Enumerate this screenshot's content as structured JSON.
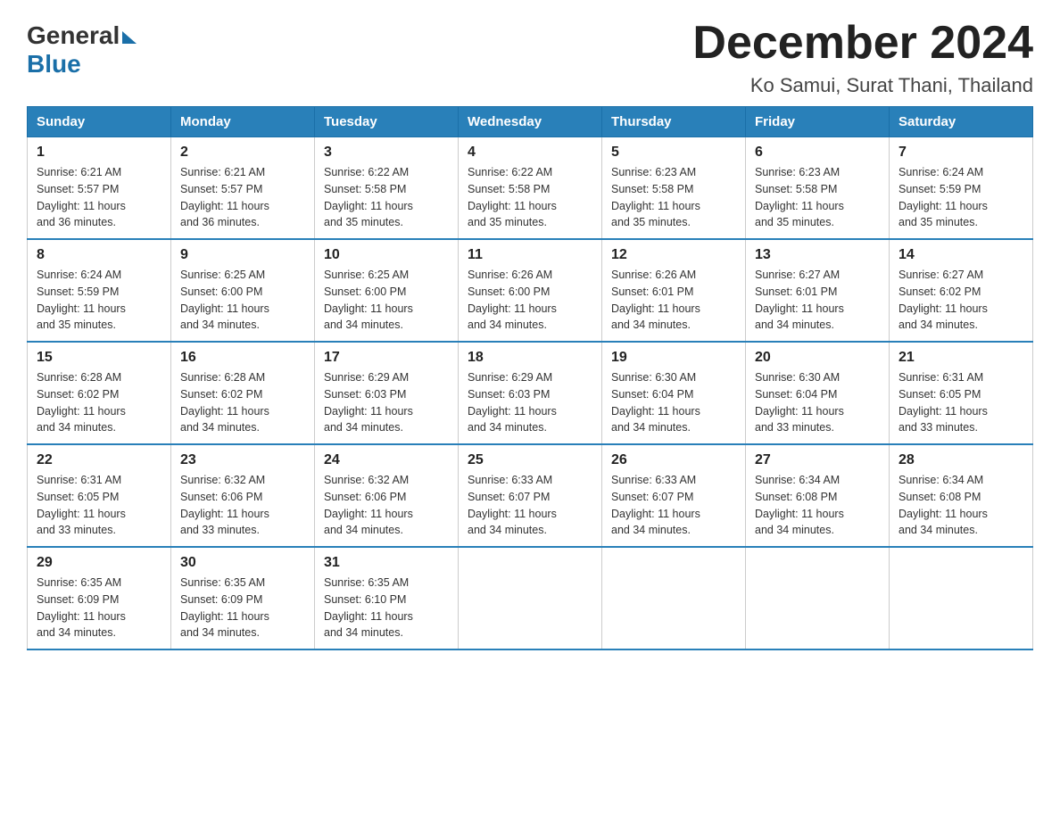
{
  "header": {
    "logo": {
      "general": "General",
      "blue": "Blue",
      "arrow_alt": "triangle arrow"
    },
    "title": "December 2024",
    "subtitle": "Ko Samui, Surat Thani, Thailand"
  },
  "calendar": {
    "headers": [
      "Sunday",
      "Monday",
      "Tuesday",
      "Wednesday",
      "Thursday",
      "Friday",
      "Saturday"
    ],
    "weeks": [
      [
        {
          "day": "1",
          "info": "Sunrise: 6:21 AM\nSunset: 5:57 PM\nDaylight: 11 hours\nand 36 minutes."
        },
        {
          "day": "2",
          "info": "Sunrise: 6:21 AM\nSunset: 5:57 PM\nDaylight: 11 hours\nand 36 minutes."
        },
        {
          "day": "3",
          "info": "Sunrise: 6:22 AM\nSunset: 5:58 PM\nDaylight: 11 hours\nand 35 minutes."
        },
        {
          "day": "4",
          "info": "Sunrise: 6:22 AM\nSunset: 5:58 PM\nDaylight: 11 hours\nand 35 minutes."
        },
        {
          "day": "5",
          "info": "Sunrise: 6:23 AM\nSunset: 5:58 PM\nDaylight: 11 hours\nand 35 minutes."
        },
        {
          "day": "6",
          "info": "Sunrise: 6:23 AM\nSunset: 5:58 PM\nDaylight: 11 hours\nand 35 minutes."
        },
        {
          "day": "7",
          "info": "Sunrise: 6:24 AM\nSunset: 5:59 PM\nDaylight: 11 hours\nand 35 minutes."
        }
      ],
      [
        {
          "day": "8",
          "info": "Sunrise: 6:24 AM\nSunset: 5:59 PM\nDaylight: 11 hours\nand 35 minutes."
        },
        {
          "day": "9",
          "info": "Sunrise: 6:25 AM\nSunset: 6:00 PM\nDaylight: 11 hours\nand 34 minutes."
        },
        {
          "day": "10",
          "info": "Sunrise: 6:25 AM\nSunset: 6:00 PM\nDaylight: 11 hours\nand 34 minutes."
        },
        {
          "day": "11",
          "info": "Sunrise: 6:26 AM\nSunset: 6:00 PM\nDaylight: 11 hours\nand 34 minutes."
        },
        {
          "day": "12",
          "info": "Sunrise: 6:26 AM\nSunset: 6:01 PM\nDaylight: 11 hours\nand 34 minutes."
        },
        {
          "day": "13",
          "info": "Sunrise: 6:27 AM\nSunset: 6:01 PM\nDaylight: 11 hours\nand 34 minutes."
        },
        {
          "day": "14",
          "info": "Sunrise: 6:27 AM\nSunset: 6:02 PM\nDaylight: 11 hours\nand 34 minutes."
        }
      ],
      [
        {
          "day": "15",
          "info": "Sunrise: 6:28 AM\nSunset: 6:02 PM\nDaylight: 11 hours\nand 34 minutes."
        },
        {
          "day": "16",
          "info": "Sunrise: 6:28 AM\nSunset: 6:02 PM\nDaylight: 11 hours\nand 34 minutes."
        },
        {
          "day": "17",
          "info": "Sunrise: 6:29 AM\nSunset: 6:03 PM\nDaylight: 11 hours\nand 34 minutes."
        },
        {
          "day": "18",
          "info": "Sunrise: 6:29 AM\nSunset: 6:03 PM\nDaylight: 11 hours\nand 34 minutes."
        },
        {
          "day": "19",
          "info": "Sunrise: 6:30 AM\nSunset: 6:04 PM\nDaylight: 11 hours\nand 34 minutes."
        },
        {
          "day": "20",
          "info": "Sunrise: 6:30 AM\nSunset: 6:04 PM\nDaylight: 11 hours\nand 33 minutes."
        },
        {
          "day": "21",
          "info": "Sunrise: 6:31 AM\nSunset: 6:05 PM\nDaylight: 11 hours\nand 33 minutes."
        }
      ],
      [
        {
          "day": "22",
          "info": "Sunrise: 6:31 AM\nSunset: 6:05 PM\nDaylight: 11 hours\nand 33 minutes."
        },
        {
          "day": "23",
          "info": "Sunrise: 6:32 AM\nSunset: 6:06 PM\nDaylight: 11 hours\nand 33 minutes."
        },
        {
          "day": "24",
          "info": "Sunrise: 6:32 AM\nSunset: 6:06 PM\nDaylight: 11 hours\nand 34 minutes."
        },
        {
          "day": "25",
          "info": "Sunrise: 6:33 AM\nSunset: 6:07 PM\nDaylight: 11 hours\nand 34 minutes."
        },
        {
          "day": "26",
          "info": "Sunrise: 6:33 AM\nSunset: 6:07 PM\nDaylight: 11 hours\nand 34 minutes."
        },
        {
          "day": "27",
          "info": "Sunrise: 6:34 AM\nSunset: 6:08 PM\nDaylight: 11 hours\nand 34 minutes."
        },
        {
          "day": "28",
          "info": "Sunrise: 6:34 AM\nSunset: 6:08 PM\nDaylight: 11 hours\nand 34 minutes."
        }
      ],
      [
        {
          "day": "29",
          "info": "Sunrise: 6:35 AM\nSunset: 6:09 PM\nDaylight: 11 hours\nand 34 minutes."
        },
        {
          "day": "30",
          "info": "Sunrise: 6:35 AM\nSunset: 6:09 PM\nDaylight: 11 hours\nand 34 minutes."
        },
        {
          "day": "31",
          "info": "Sunrise: 6:35 AM\nSunset: 6:10 PM\nDaylight: 11 hours\nand 34 minutes."
        },
        {
          "day": "",
          "info": ""
        },
        {
          "day": "",
          "info": ""
        },
        {
          "day": "",
          "info": ""
        },
        {
          "day": "",
          "info": ""
        }
      ]
    ]
  }
}
